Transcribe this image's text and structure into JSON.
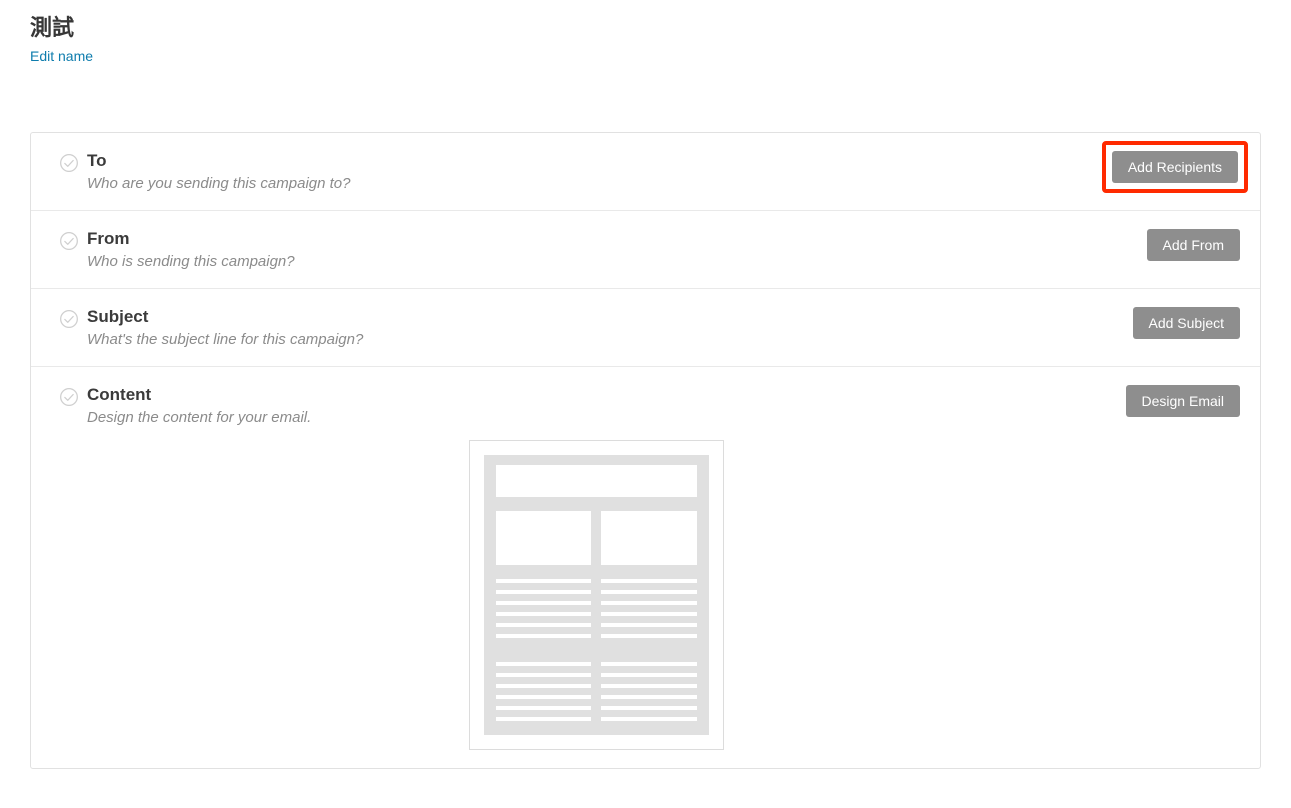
{
  "campaign": {
    "title": "測試",
    "edit_name_label": "Edit name"
  },
  "sections": {
    "to": {
      "title": "To",
      "desc": "Who are you sending this campaign to?",
      "button": "Add Recipients",
      "highlighted": true
    },
    "from": {
      "title": "From",
      "desc": "Who is sending this campaign?",
      "button": "Add From"
    },
    "subject": {
      "title": "Subject",
      "desc": "What's the subject line for this campaign?",
      "button": "Add Subject"
    },
    "content": {
      "title": "Content",
      "desc": "Design the content for your email.",
      "button": "Design Email"
    }
  }
}
